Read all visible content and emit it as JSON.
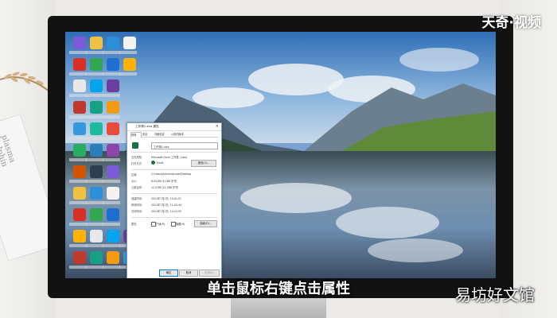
{
  "watermarks": {
    "top_right": "天奇·视频",
    "bottom_right": "易坊好文馆"
  },
  "subtitle": "单击鼠标右键点击属性",
  "book": {
    "spine_text": "plasma dolphin go"
  },
  "dialog": {
    "title": "工作簿1.xlsx 属性",
    "tabs": [
      "常规",
      "安全",
      "详细信息",
      "以前的版本"
    ],
    "active_tab": "常规",
    "file_name": "工作簿1.xlsx",
    "rows": [
      {
        "label": "文件类型:",
        "value": "Microsoft Excel 工作表 (.xlsx)"
      },
      {
        "label": "打开方式:",
        "value": "Excel"
      },
      {
        "label": "位置:",
        "value": "C:\\Users\\Administrator\\Desktop"
      },
      {
        "label": "大小:",
        "value": "6.62 KB (6,786 字节)"
      },
      {
        "label": "占用空间:",
        "value": "12.0 KB (12,288 字节)"
      },
      {
        "label": "创建时间:",
        "value": "2021年7月1日, 10:01:51"
      },
      {
        "label": "修改时间:",
        "value": "2021年7月1日, 11:02:44"
      },
      {
        "label": "访问时间:",
        "value": "2021年7月1日, 14:13:55"
      }
    ],
    "change_button": "更改(C)...",
    "attributes_label": "属性:",
    "readonly_label": "只读(R)",
    "hidden_label": "隐藏(H)",
    "advanced_button": "高级(D)...",
    "ok_button": "确定",
    "cancel_button": "取消",
    "apply_button": "应用(A)"
  },
  "desktop_icon_colors": [
    "#7b5cd6",
    "#f0c040",
    "#2b8fd9",
    "#f3f3f3",
    "#d93025",
    "#2fa84f",
    "#1f6fd0",
    "#ffb300",
    "#e8e8e8",
    "#00a4ef",
    "#6b3fa0",
    "#c0392b",
    "#16a085",
    "#f39c12",
    "#3498db",
    "#1abc9c",
    "#e74c3c",
    "#27ae60",
    "#2980b9",
    "#8e44ad",
    "#d35400",
    "#2c3e50"
  ]
}
